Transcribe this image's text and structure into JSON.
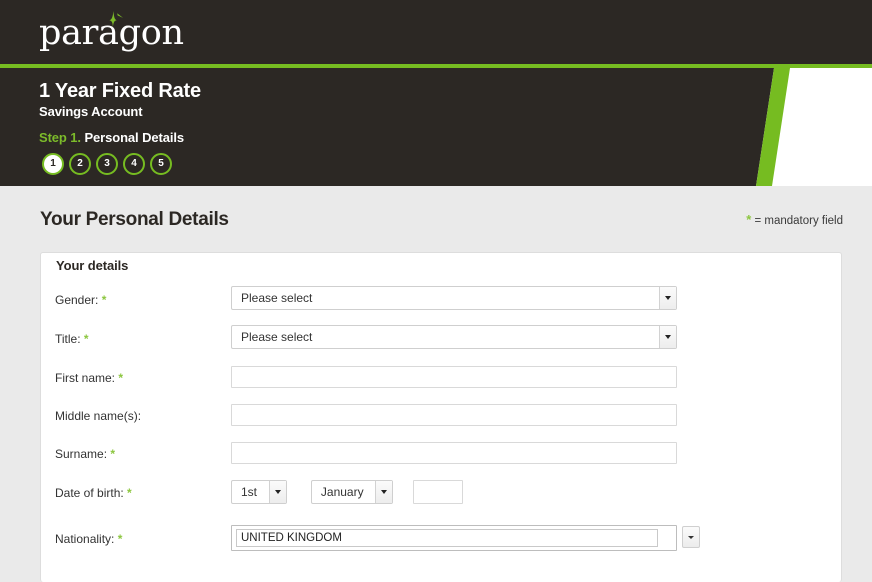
{
  "brand": {
    "logo_text": "paragon",
    "logo_star_icon": "sparkle-icon",
    "accent_green": "#76bc21",
    "dark": "#2c2824",
    "page_bg": "#eaeaea"
  },
  "banner": {
    "title": "1 Year Fixed Rate",
    "subtitle": "Savings Account",
    "step_number": "Step 1.",
    "step_label": " Personal Details",
    "steps": [
      {
        "label": "1",
        "active": true
      },
      {
        "label": "2",
        "active": false
      },
      {
        "label": "3",
        "active": false
      },
      {
        "label": "4",
        "active": false
      },
      {
        "label": "5",
        "active": false
      }
    ]
  },
  "page": {
    "title": "Your Personal Details",
    "mandatory_note": "= mandatory field",
    "mandatory_marker": "*"
  },
  "panel": {
    "heading": "Your details",
    "fields": {
      "gender": {
        "label": "Gender:",
        "required": true,
        "value": "Please select"
      },
      "title": {
        "label": "Title:",
        "required": true,
        "value": "Please select"
      },
      "first_name": {
        "label": "First name:",
        "required": true,
        "value": "",
        "placeholder": ""
      },
      "middle_names": {
        "label": "Middle name(s):",
        "required": false,
        "value": "",
        "placeholder": ""
      },
      "surname": {
        "label": "Surname:",
        "required": true,
        "value": "",
        "placeholder": ""
      },
      "date_of_birth": {
        "label": "Date of birth:",
        "required": true,
        "day": "1st",
        "month": "January",
        "year": "",
        "year_placeholder": ""
      },
      "nationality": {
        "label": "Nationality:",
        "required": true,
        "value": "UNITED KINGDOM"
      }
    }
  }
}
